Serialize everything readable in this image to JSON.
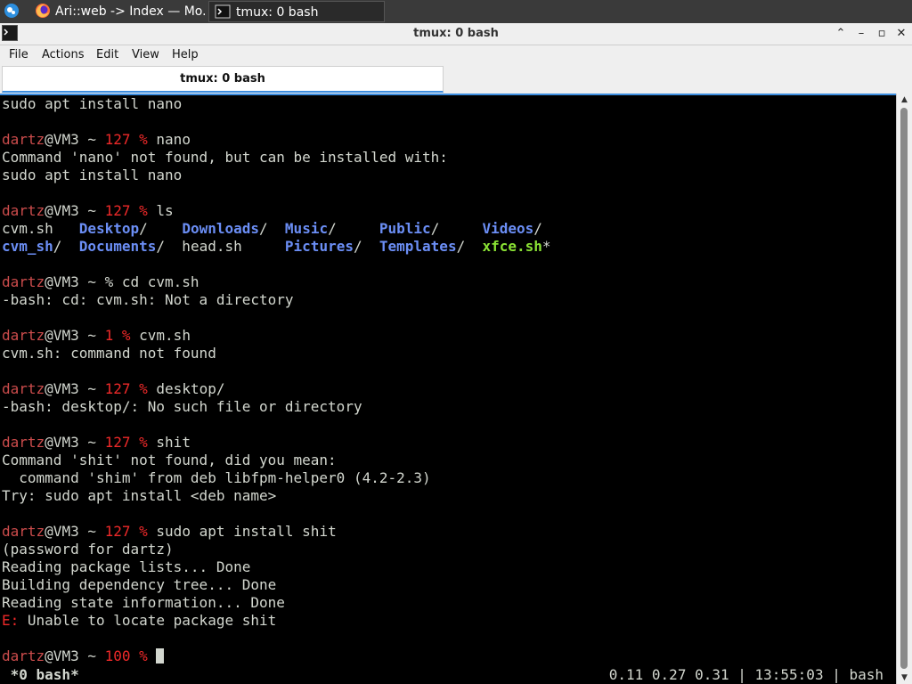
{
  "colors": {
    "prompt_user": "#cc4c4c",
    "error": "#ef2929",
    "directory": "#6b8ef5",
    "executable": "#8ae234",
    "text": "#d3d7cf",
    "accent": "#3d8ee0"
  },
  "taskbar": {
    "start_icon": "xfce-mouse-icon",
    "items": [
      {
        "icon": "firefox-icon",
        "label": "Ari::web -> Index — Mo..."
      },
      {
        "icon": "terminal-icon",
        "label": "tmux: 0 bash"
      }
    ]
  },
  "window": {
    "title": "tmux: 0 bash",
    "icon": "terminal-icon",
    "controls": {
      "maximize_icon": "⌃",
      "minimize_icon": "–",
      "restore_icon": "▫",
      "close_icon": "✕"
    }
  },
  "menubar": {
    "file": "File",
    "actions": "Actions",
    "edit": "Edit",
    "view": "View",
    "help": "Help"
  },
  "tabs": [
    {
      "label": "tmux: 0 bash",
      "active": true
    }
  ],
  "terminal": {
    "lines": [
      [
        {
          "t": "sudo apt install nano"
        }
      ],
      [],
      [
        {
          "t": "dartz",
          "c": "usr"
        },
        {
          "t": "@VM3 ~ "
        },
        {
          "t": "127 %",
          "c": "err"
        },
        {
          "t": " nano"
        }
      ],
      [
        {
          "t": "Command 'nano' not found, but can be installed with:"
        }
      ],
      [
        {
          "t": "sudo apt install nano"
        }
      ],
      [],
      [
        {
          "t": "dartz",
          "c": "usr"
        },
        {
          "t": "@VM3 ~ "
        },
        {
          "t": "127 %",
          "c": "err"
        },
        {
          "t": " ls"
        }
      ],
      [
        {
          "t": "cvm.sh   "
        },
        {
          "t": "Desktop",
          "c": "dir"
        },
        {
          "t": "/    "
        },
        {
          "t": "Downloads",
          "c": "dir"
        },
        {
          "t": "/  "
        },
        {
          "t": "Music",
          "c": "dir"
        },
        {
          "t": "/     "
        },
        {
          "t": "Public",
          "c": "dir"
        },
        {
          "t": "/     "
        },
        {
          "t": "Videos",
          "c": "dir"
        },
        {
          "t": "/"
        }
      ],
      [
        {
          "t": "cvm_sh",
          "c": "dir"
        },
        {
          "t": "/  "
        },
        {
          "t": "Documents",
          "c": "dir"
        },
        {
          "t": "/  head.sh     "
        },
        {
          "t": "Pictures",
          "c": "dir"
        },
        {
          "t": "/  "
        },
        {
          "t": "Templates",
          "c": "dir"
        },
        {
          "t": "/  "
        },
        {
          "t": "xfce.sh",
          "c": "exe"
        },
        {
          "t": "*"
        }
      ],
      [],
      [
        {
          "t": "dartz",
          "c": "usr"
        },
        {
          "t": "@VM3 ~ % cd cvm.sh"
        }
      ],
      [
        {
          "t": "-bash: cd: cvm.sh: Not a directory"
        }
      ],
      [],
      [
        {
          "t": "dartz",
          "c": "usr"
        },
        {
          "t": "@VM3 ~ "
        },
        {
          "t": "1 %",
          "c": "err"
        },
        {
          "t": " cvm.sh"
        }
      ],
      [
        {
          "t": "cvm.sh: command not found"
        }
      ],
      [],
      [
        {
          "t": "dartz",
          "c": "usr"
        },
        {
          "t": "@VM3 ~ "
        },
        {
          "t": "127 %",
          "c": "err"
        },
        {
          "t": " desktop/"
        }
      ],
      [
        {
          "t": "-bash: desktop/: No such file or directory"
        }
      ],
      [],
      [
        {
          "t": "dartz",
          "c": "usr"
        },
        {
          "t": "@VM3 ~ "
        },
        {
          "t": "127 %",
          "c": "err"
        },
        {
          "t": " shit"
        }
      ],
      [
        {
          "t": "Command 'shit' not found, did you mean:"
        }
      ],
      [
        {
          "t": "  command 'shim' from deb libfpm-helper0 (4.2-2.3)"
        }
      ],
      [
        {
          "t": "Try: sudo apt install <deb name>"
        }
      ],
      [],
      [
        {
          "t": "dartz",
          "c": "usr"
        },
        {
          "t": "@VM3 ~ "
        },
        {
          "t": "127 %",
          "c": "err"
        },
        {
          "t": " sudo apt install shit"
        }
      ],
      [
        {
          "t": "(password for dartz)"
        }
      ],
      [
        {
          "t": "Reading package lists... Done"
        }
      ],
      [
        {
          "t": "Building dependency tree... Done"
        }
      ],
      [
        {
          "t": "Reading state information... Done"
        }
      ],
      [
        {
          "t": "E:",
          "c": "err"
        },
        {
          "t": " Unable to locate package shit"
        }
      ],
      [],
      [
        {
          "t": "dartz",
          "c": "usr"
        },
        {
          "t": "@VM3 ~ "
        },
        {
          "t": "100 %",
          "c": "err"
        },
        {
          "t": " "
        },
        {
          "cursor": true
        }
      ]
    ]
  },
  "tmux_status": {
    "left": " *0 bash*",
    "right": "0.11 0.27 0.31 | 13:55:03 | bash"
  },
  "scrollbar": {
    "up_icon": "▲",
    "down_icon": "▼"
  }
}
